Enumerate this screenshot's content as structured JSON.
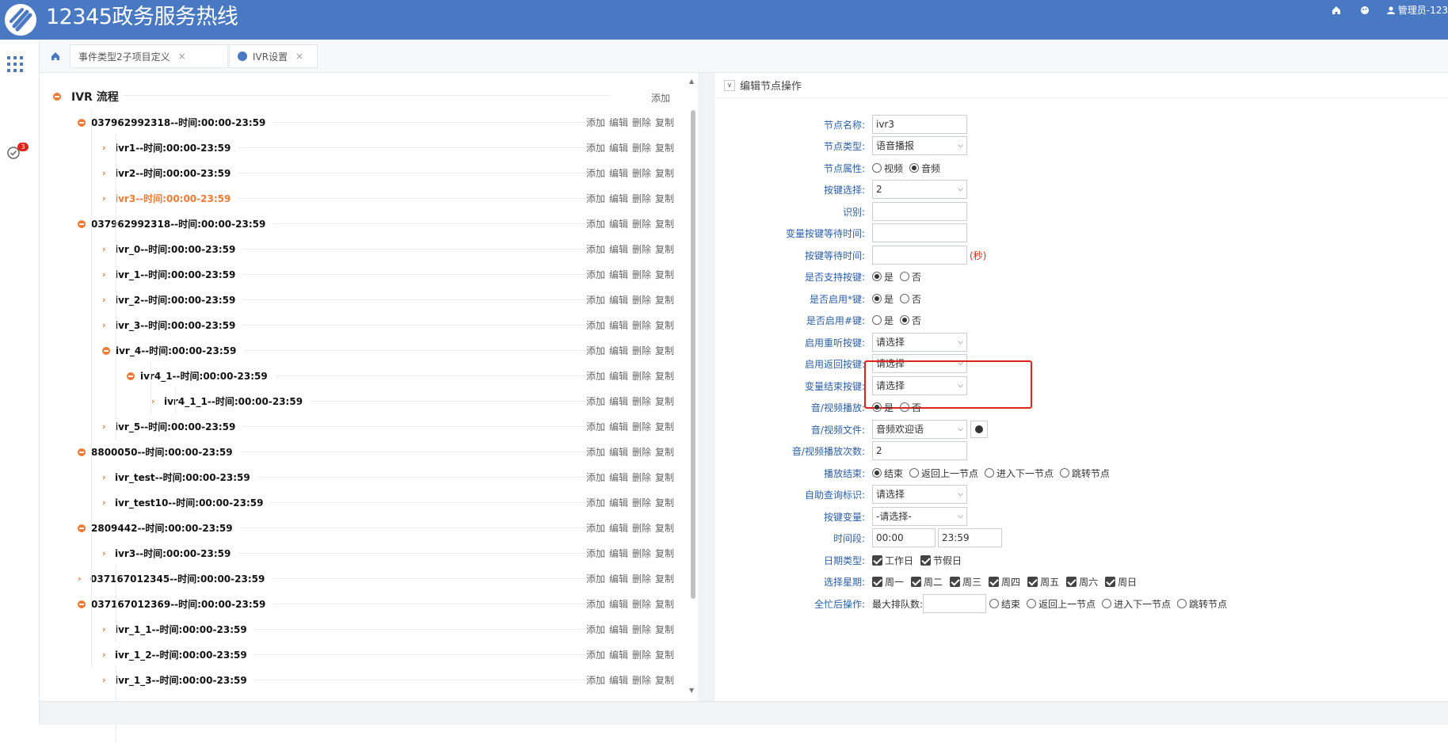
{
  "app": {
    "title": "12345政务服务热线",
    "colors": {
      "header": "#4a79c4",
      "accent": "#f07a35",
      "label": "#2b5fa8",
      "highlight": "#e2231a"
    }
  },
  "header": {
    "user": "管理员-123",
    "icons": [
      "home-icon",
      "palette-icon",
      "user-icon"
    ]
  },
  "sidebar": {
    "badge": "3"
  },
  "tabs": [
    {
      "label": "事件类型2子项目定义",
      "close": "×"
    },
    {
      "label": "IVR设置",
      "close": "×"
    }
  ],
  "tree": {
    "root": {
      "label": "IVR 流程",
      "add": "添加"
    },
    "ops": [
      "添加",
      "编辑",
      "删除",
      "复制"
    ],
    "rows": [
      {
        "label": "037962992318--时间:00:00-23:59",
        "level": 0,
        "icon": "minus"
      },
      {
        "label": "ivr1--时间:00:00-23:59",
        "level": 1,
        "icon": "chev"
      },
      {
        "label": "ivr2--时间:00:00-23:59",
        "level": 1,
        "icon": "chev"
      },
      {
        "label": "ivr3--时间:00:00-23:59",
        "level": 1,
        "icon": "chev",
        "active": true
      },
      {
        "label": "037962992318--时间:00:00-23:59",
        "level": 0,
        "icon": "minus"
      },
      {
        "label": "ivr_0--时间:00:00-23:59",
        "level": 1,
        "icon": "chev"
      },
      {
        "label": "ivr_1--时间:00:00-23:59",
        "level": 1,
        "icon": "chev"
      },
      {
        "label": "ivr_2--时间:00:00-23:59",
        "level": 1,
        "icon": "chev"
      },
      {
        "label": "ivr_3--时间:00:00-23:59",
        "level": 1,
        "icon": "chev"
      },
      {
        "label": "ivr_4--时间:00:00-23:59",
        "level": 1,
        "icon": "minus"
      },
      {
        "label": "ivr4_1--时间:00:00-23:59",
        "level": 2,
        "icon": "minus"
      },
      {
        "label": "ivr4_1_1--时间:00:00-23:59",
        "level": 3,
        "icon": "chev"
      },
      {
        "label": "ivr_5--时间:00:00-23:59",
        "level": 1,
        "icon": "chev"
      },
      {
        "label": "8800050--时间:00:00-23:59",
        "level": 0,
        "icon": "minus"
      },
      {
        "label": "ivr_test--时间:00:00-23:59",
        "level": 1,
        "icon": "chev"
      },
      {
        "label": "ivr_test10--时间:00:00-23:59",
        "level": 1,
        "icon": "chev"
      },
      {
        "label": "2809442--时间:00:00-23:59",
        "level": 0,
        "icon": "minus"
      },
      {
        "label": "ivr3--时间:00:00-23:59",
        "level": 1,
        "icon": "chev"
      },
      {
        "label": "037167012345--时间:00:00-23:59",
        "level": 0,
        "icon": "chev"
      },
      {
        "label": "037167012369--时间:00:00-23:59",
        "level": 0,
        "icon": "minus"
      },
      {
        "label": "ivr_1_1--时间:00:00-23:59",
        "level": 1,
        "icon": "chev"
      },
      {
        "label": "ivr_1_2--时间:00:00-23:59",
        "level": 1,
        "icon": "chev"
      },
      {
        "label": "ivr_1_3--时间:00:00-23:59",
        "level": 1,
        "icon": "chev"
      }
    ]
  },
  "form": {
    "section_title": "编辑节点操作",
    "node_name": {
      "label": "节点名称:",
      "value": "ivr3"
    },
    "node_type": {
      "label": "节点类型:",
      "value": "语音播报"
    },
    "node_attr": {
      "label": "节点属性:",
      "options": [
        "视频",
        "音频"
      ],
      "selected": 1
    },
    "key_select": {
      "label": "按键选择:",
      "value": "2"
    },
    "recognize": {
      "label": "识别:",
      "value": ""
    },
    "var_key_wait": {
      "label": "变量按键等待时间:",
      "value": ""
    },
    "key_wait": {
      "label": "按键等待时间:",
      "value": "",
      "unit": "(秒)"
    },
    "support_key": {
      "label": "是否支持按键:",
      "options": [
        "是",
        "否"
      ],
      "selected": 0
    },
    "enable_star": {
      "label": "是否启用*键:",
      "options": [
        "是",
        "否"
      ],
      "selected": 0
    },
    "enable_hash": {
      "label": "是否启用#键:",
      "options": [
        "是",
        "否"
      ],
      "selected": 1
    },
    "replay_key": {
      "label": "启用重听按键:",
      "value": "请选择"
    },
    "return_key": {
      "label": "启用返回按键:",
      "value": "请选择"
    },
    "var_end_key": {
      "label": "变量结束按键:",
      "value": "请选择"
    },
    "av_play": {
      "label": "音/视频播放:",
      "options": [
        "是",
        "否"
      ],
      "selected": 0
    },
    "av_file": {
      "label": "音/视频文件:",
      "value": "音频欢迎语"
    },
    "av_count": {
      "label": "音/视频播放次数:",
      "value": "2"
    },
    "play_end": {
      "label": "播放结束:",
      "options": [
        "结束",
        "返回上一节点",
        "进入下一节点",
        "跳转节点"
      ],
      "selected": 0
    },
    "self_query": {
      "label": "自助查询标识:",
      "value": "请选择"
    },
    "key_var": {
      "label": "按键变量:",
      "value": "-请选择-"
    },
    "time_range": {
      "label": "时间段:",
      "start": "00:00",
      "end": "23:59"
    },
    "date_type": {
      "label": "日期类型:",
      "options": [
        "工作日",
        "节假日"
      ]
    },
    "weekdays": {
      "label": "选择星期:",
      "options": [
        "周一",
        "周二",
        "周三",
        "周四",
        "周五",
        "周六",
        "周日"
      ]
    },
    "busy_op": {
      "label": "全忙后操作:",
      "queue_label": "最大排队数:",
      "queue_value": "",
      "options": [
        "结束",
        "返回上一节点",
        "进入下一节点",
        "跳转节点"
      ]
    }
  }
}
